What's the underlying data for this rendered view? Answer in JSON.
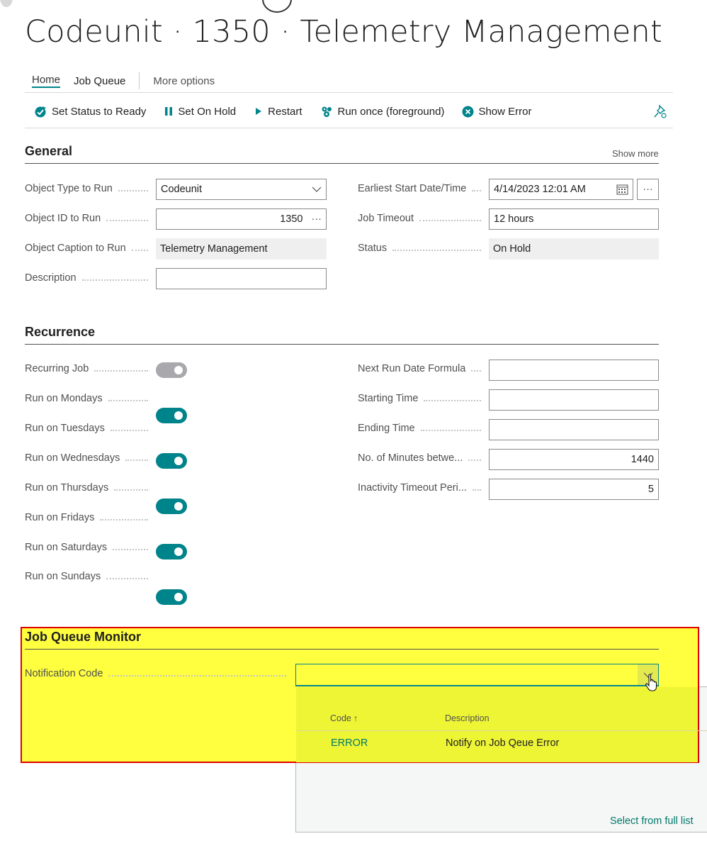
{
  "page": {
    "title": "Codeunit · 1350 · Telemetry Management"
  },
  "tabs": [
    {
      "label": "Home"
    },
    {
      "label": "Job Queue"
    },
    {
      "label": "More options"
    }
  ],
  "actions": [
    {
      "label": "Set Status to Ready",
      "icon": "set-status-ready-icon"
    },
    {
      "label": "Set On Hold",
      "icon": "pause-icon"
    },
    {
      "label": "Restart",
      "icon": "play-icon"
    },
    {
      "label": "Run once (foreground)",
      "icon": "run-once-icon"
    },
    {
      "label": "Show Error",
      "icon": "error-icon"
    }
  ],
  "general": {
    "title": "General",
    "show_more": "Show more",
    "object_type_label": "Object Type to Run",
    "object_type_value": "Codeunit",
    "object_id_label": "Object ID to Run",
    "object_id_value": "1350",
    "object_caption_label": "Object Caption to Run",
    "object_caption_value": "Telemetry Management",
    "description_label": "Description",
    "description_value": "",
    "earliest_start_label": "Earliest Start Date/Time",
    "earliest_start_value": "4/14/2023 12:01 AM",
    "job_timeout_label": "Job Timeout",
    "job_timeout_value": "12 hours",
    "status_label": "Status",
    "status_value": "On Hold",
    "ellipsis": "···"
  },
  "recurrence": {
    "title": "Recurrence",
    "toggles": [
      {
        "label": "Recurring Job",
        "on": false
      },
      {
        "label": "Run on Mondays",
        "on": true
      },
      {
        "label": "Run on Tuesdays",
        "on": true
      },
      {
        "label": "Run on Wednesdays",
        "on": true
      },
      {
        "label": "Run on Thursdays",
        "on": true
      },
      {
        "label": "Run on Fridays",
        "on": true
      },
      {
        "label": "Run on Saturdays",
        "on": true
      },
      {
        "label": "Run on Sundays",
        "on": true
      }
    ],
    "next_run_label": "Next Run Date Formula",
    "next_run_value": "",
    "starting_time_label": "Starting Time",
    "starting_time_value": "",
    "ending_time_label": "Ending Time",
    "ending_time_value": "",
    "minutes_between_label": "No. of Minutes betwe...",
    "minutes_between_value": "1440",
    "inactivity_label": "Inactivity Timeout Peri...",
    "inactivity_value": "5"
  },
  "monitor": {
    "title": "Job Queue Monitor",
    "notification_code_label": "Notification Code",
    "notification_code_value": "",
    "dropdown": {
      "col_code": "Code",
      "sort_indicator": "↑",
      "col_description": "Description",
      "rows": [
        {
          "code": "ERROR",
          "description": "Notify on Job Qeue Error"
        }
      ],
      "select_full_list": "Select from full list"
    }
  },
  "colors": {
    "accent": "#00848b",
    "highlight": "#ffff40",
    "highlight_border": "#e00000",
    "link": "#00796b"
  }
}
